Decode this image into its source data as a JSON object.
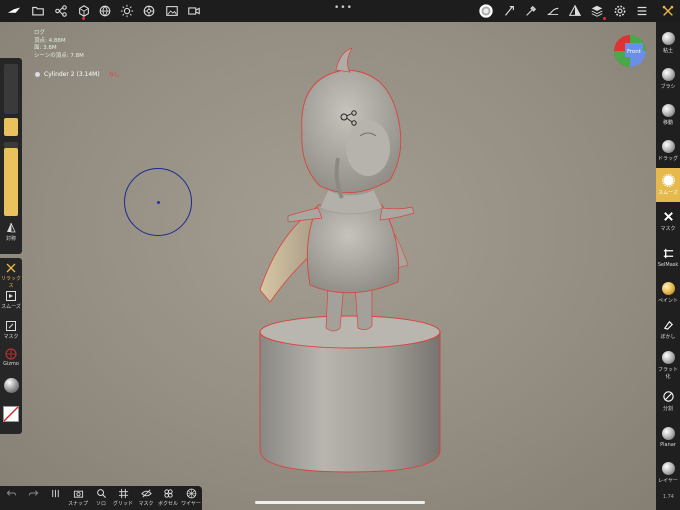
{
  "topbar": {
    "center_dots": "•••"
  },
  "info": {
    "lines": [
      "ログ",
      "頂点: 4.88M",
      "面: 3.8M",
      "シーンの頂点: 7.8M"
    ],
    "object": "Cylinder 2 (3.14M)",
    "object_flag": "なし"
  },
  "left": {
    "symmetry": "対称",
    "relax": "リラックス",
    "smooth": "スムーズ",
    "mask": "マスク",
    "gizmo": "Gizmo"
  },
  "right": {
    "items": [
      "粘土",
      "ブラシ",
      "移動",
      "ドラッグ",
      "スムーズ",
      "マスク",
      "SelMask",
      "ペイント",
      "ぼかし",
      "フラット化",
      "分割",
      "Planar",
      "レイヤー"
    ],
    "active_index": 4,
    "version": "1.74"
  },
  "bottom": {
    "snap": "スナップ",
    "solo": "ソロ",
    "grid": "グリッド",
    "mask": "マスク",
    "voxel": "ボクセル",
    "wire": "ワイヤー"
  },
  "cube": {
    "front": "Front"
  },
  "colors": {
    "accent": "#e6b94d",
    "panel": "#1f1f1f",
    "outline": "#d9443f"
  }
}
